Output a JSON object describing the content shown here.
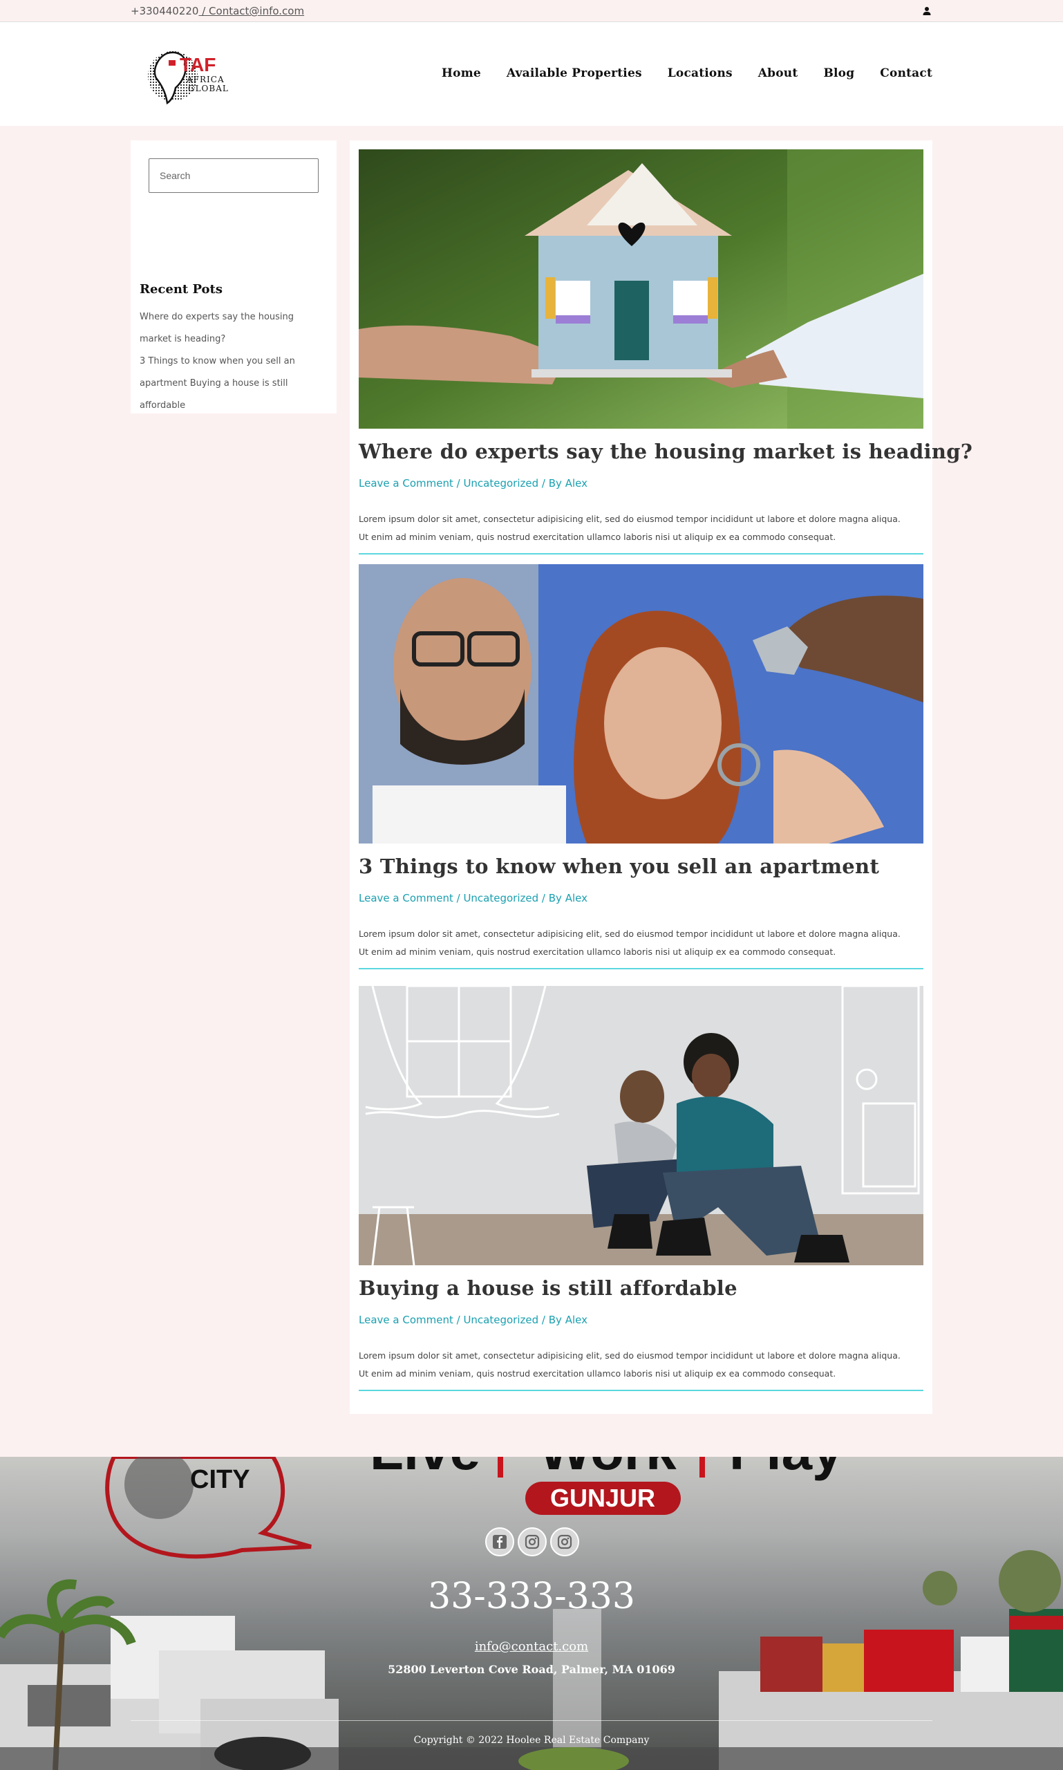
{
  "topbar": {
    "phone": "+330440220",
    "email": " / Contact@info.com"
  },
  "logo": {
    "brand": "TAF",
    "line1": "AFRICA",
    "line2": "GLOBAL"
  },
  "nav": {
    "items": [
      "Home",
      "Available Properties",
      "Locations",
      "About",
      "Blog",
      "Contact"
    ]
  },
  "sidebar": {
    "search_placeholder": "Search",
    "recent_title": "Recent Pots",
    "recent_lines": [
      "Where do experts say the housing",
      "market is heading?",
      "3 Things to know when you sell an",
      "apartment Buying a house is still",
      "affordable"
    ]
  },
  "posts": [
    {
      "title": "Where do experts say the housing market is heading?",
      "comment_link": "Leave a Comment",
      "category": "Uncategorized",
      "author_prefix": "By",
      "author": "Alex",
      "excerpt_1": "Lorem ipsum dolor sit amet, consectetur adipisicing elit, sed do eiusmod tempor incididunt ut labore et dolore magna aliqua.",
      "excerpt_2": "Ut enim ad minim veniam, quis nostrud exercitation ullamco laboris nisi ut aliquip ex ea commodo consequat."
    },
    {
      "title": "3 Things to know when you sell an apartment",
      "comment_link": "Leave a Comment",
      "category": "Uncategorized",
      "author_prefix": "By",
      "author": "Alex",
      "excerpt_1": "Lorem ipsum dolor sit amet, consectetur adipisicing elit, sed do eiusmod tempor incididunt ut labore et dolore magna aliqua.",
      "excerpt_2": "Ut enim ad minim veniam, quis nostrud exercitation ullamco laboris nisi ut aliquip ex ea commodo consequat."
    },
    {
      "title": "Buying a house is still affordable",
      "comment_link": "Leave a Comment",
      "category": "Uncategorized",
      "author_prefix": "By",
      "author": "Alex",
      "excerpt_1": "Lorem ipsum dolor sit amet, consectetur adipisicing elit, sed do eiusmod tempor incididunt ut labore et dolore magna aliqua.",
      "excerpt_2": "Ut enim ad minim veniam, quis nostrud exercitation ullamco laboris nisi ut aliquip ex ea commodo consequat."
    }
  ],
  "footer": {
    "banner_words": [
      "Live",
      "Work",
      "Play"
    ],
    "banner_place": "GUNJUR",
    "city_logo": "CITY",
    "phone": "33-333-333",
    "email": "info@contact.com",
    "address": "52800 Leverton Cove Road, Palmer, MA 01069",
    "copyright": "Copyright © 2022 Hoolee Real Estate Company"
  },
  "colors": {
    "accent": "#1aa0b0",
    "rule": "#5ad7df",
    "page_bg": "#fcf1f1",
    "brand_red": "#d0202a"
  },
  "icons": [
    "user-icon",
    "facebook-icon",
    "instagram-icon"
  ]
}
